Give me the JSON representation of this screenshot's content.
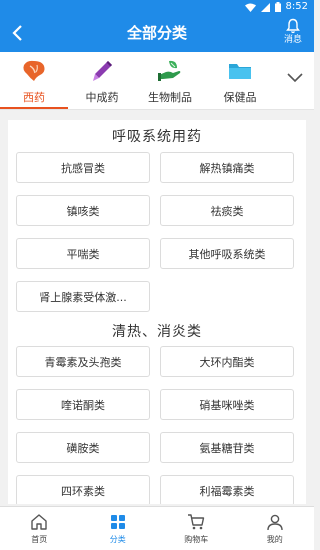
{
  "status_bar": {
    "time": "8:52"
  },
  "header": {
    "title": "全部分类",
    "message_label": "消息"
  },
  "category_tabs": [
    {
      "label": "西药",
      "icon": "liver-organ-icon",
      "active": true
    },
    {
      "label": "中成药",
      "icon": "pen-medicine-icon",
      "active": false
    },
    {
      "label": "生物制品",
      "icon": "hand-leaf-icon",
      "active": false
    },
    {
      "label": "保健品",
      "icon": "folder-health-icon",
      "active": false
    }
  ],
  "sections": [
    {
      "title": "呼吸系统用药",
      "items": [
        "抗感冒类",
        "解热镇痛类",
        "镇咳类",
        "祛痰类",
        "平喘类",
        "其他呼吸系统类",
        "肾上腺素受体激..."
      ]
    },
    {
      "title": "清热、消炎类",
      "items": [
        "青霉素及头孢类",
        "大环内酯类",
        "喹诺酮类",
        "硝基咪唑类",
        "磺胺类",
        "氨基糖苷类",
        "四环素类",
        "利福霉素类"
      ]
    }
  ],
  "bottom_nav": [
    {
      "label": "首页",
      "icon": "home-icon",
      "active": false
    },
    {
      "label": "分类",
      "icon": "grid-icon",
      "active": true
    },
    {
      "label": "购物车",
      "icon": "cart-icon",
      "active": false
    },
    {
      "label": "我的",
      "icon": "user-icon",
      "active": false
    }
  ],
  "colors": {
    "primary": "#1f8be8",
    "accent": "#e8521f",
    "background": "#f1f1f1"
  }
}
